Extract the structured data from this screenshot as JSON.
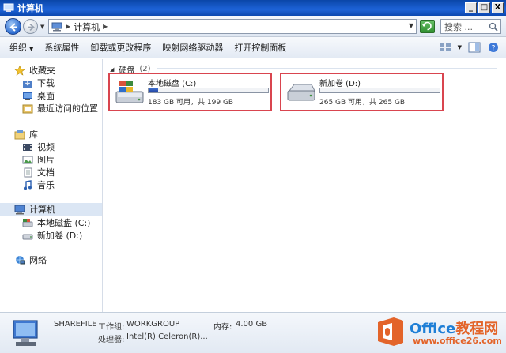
{
  "window": {
    "title": "计算机",
    "buttons": {
      "minimize": "_",
      "maximize": "□",
      "close": "X"
    }
  },
  "address": {
    "breadcrumb": "计算机",
    "search_placeholder": "搜索 ..."
  },
  "toolbar": {
    "organize": "组织",
    "system_properties": "系统属性",
    "uninstall": "卸载或更改程序",
    "map_drive": "映射网络驱动器",
    "control_panel": "打开控制面板"
  },
  "sidebar": {
    "favorites": "收藏夹",
    "downloads": "下载",
    "desktop": "桌面",
    "recent": "最近访问的位置",
    "libraries": "库",
    "videos": "视频",
    "pictures": "图片",
    "documents": "文档",
    "music": "音乐",
    "computer": "计算机",
    "drive_c": "本地磁盘 (C:)",
    "drive_d": "新加卷 (D:)",
    "network": "网络"
  },
  "content": {
    "group_label": "硬盘",
    "group_count": "(2)",
    "drives": [
      {
        "name": "本地磁盘 (C:)",
        "space": "183 GB 可用，共 199 GB",
        "used_fraction": 0.08
      },
      {
        "name": "新加卷 (D:)",
        "space": "265 GB 可用，共 265 GB",
        "used_fraction": 0.0
      }
    ]
  },
  "details": {
    "computer_name": "SHAREFILE",
    "workgroup_label": "工作组:",
    "workgroup": "WORKGROUP",
    "memory_label": "内存:",
    "memory": "4.00 GB",
    "processor_label": "处理器:",
    "processor": "Intel(R) Celeron(R)..."
  },
  "watermark": {
    "title_prefix": "Office",
    "title_cn": "教程网",
    "url": "www.office26.com"
  },
  "colors": {
    "highlight_border": "#d9454f",
    "titlebar": "#1d63d8",
    "watermark_orange": "#e3642a",
    "watermark_blue": "#1f7fd6"
  }
}
